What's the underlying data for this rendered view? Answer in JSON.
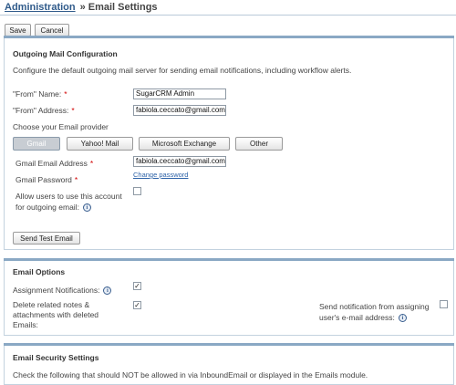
{
  "header": {
    "breadcrumb": "Administration",
    "separator": "»",
    "title": "Email Settings"
  },
  "toolbar": {
    "save_label": "Save",
    "cancel_label": "Cancel"
  },
  "outgoing": {
    "section_title": "Outgoing Mail Configuration",
    "description": "Configure the default outgoing mail server for sending email notifications, including workflow alerts.",
    "from_name_label": "\"From\" Name:",
    "from_name_value": "SugarCRM Admin",
    "from_address_label": "\"From\" Address:",
    "from_address_value": "fabiola.ceccato@gmail.com",
    "provider_label": "Choose your Email provider",
    "providers": [
      "Gmail",
      "Yahoo! Mail",
      "Microsoft Exchange",
      "Other"
    ],
    "selected_provider": "Gmail",
    "gmail_address_label": "Gmail Email Address",
    "gmail_address_value": "fabiola.ceccato@gmail.com",
    "gmail_password_label": "Gmail Password",
    "change_password_link": "Change password",
    "allow_users_label_line1": "Allow users to use this account",
    "allow_users_label_line2": "for outgoing email:",
    "allow_users_checked": false,
    "send_test_label": "Send Test Email"
  },
  "email_options": {
    "section_title": "Email Options",
    "assignment_label": "Assignment Notifications:",
    "assignment_checked": true,
    "delete_related_line1": "Delete related notes &",
    "delete_related_line2": "attachments with deleted",
    "delete_related_line3": "Emails:",
    "delete_related_checked": true,
    "send_notification_line1": "Send notification from assigning",
    "send_notification_line2": "user's e-mail address:",
    "send_notification_checked": false
  },
  "security": {
    "section_title": "Email Security Settings",
    "description": "Check the following that should NOT be allowed in via InboundEmail or displayed in the Emails module."
  },
  "icons": {
    "info": "i",
    "check": "✓"
  },
  "colors": {
    "link": "#2e63a8",
    "required": "#d10000",
    "panel_border": "#c3d2df",
    "panel_accent": "#8aa8c4"
  }
}
